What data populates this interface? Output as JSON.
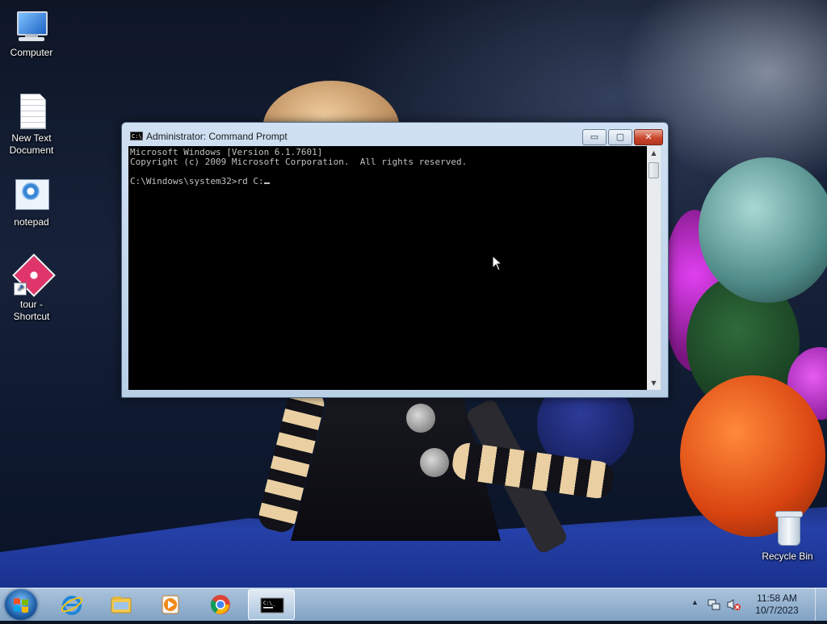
{
  "desktop": {
    "icons": [
      {
        "label": "Computer",
        "icon": "computer-icon"
      },
      {
        "label": "New Text\nDocument",
        "icon": "text-document-icon"
      },
      {
        "label": "notepad",
        "icon": "notepad-icon"
      },
      {
        "label": "tour -\nShortcut",
        "icon": "tour-shortcut-icon"
      },
      {
        "label": "Recycle Bin",
        "icon": "recycle-bin-icon"
      }
    ]
  },
  "cmd": {
    "title": "Administrator: Command Prompt",
    "icon_text": "C:\\_",
    "buttons": {
      "minimize": "▭",
      "maximize": "▢",
      "close": "✕"
    },
    "lines": [
      "Microsoft Windows [Version 6.1.7601]",
      "Copyright (c) 2009 Microsoft Corporation.  All rights reserved.",
      "",
      "C:\\Windows\\system32>rd C:"
    ],
    "scroll_up": "▲",
    "scroll_down": "▼"
  },
  "taskbar": {
    "pinned": [
      {
        "name": "internet-explorer",
        "icon": "ie-icon"
      },
      {
        "name": "file-explorer",
        "icon": "folder-icon"
      },
      {
        "name": "media-player",
        "icon": "media-player-icon"
      },
      {
        "name": "chrome",
        "icon": "chrome-icon"
      },
      {
        "name": "command-prompt",
        "icon": "cmd-icon",
        "active": true
      }
    ],
    "tray": {
      "chevron": "▲",
      "time": "11:58 AM",
      "date": "10/7/2023"
    }
  },
  "colors": {
    "console_bg": "#000000",
    "console_fg": "#c0c0c0",
    "close_red": "#c9462c",
    "taskbar": "#a9c4e0"
  }
}
